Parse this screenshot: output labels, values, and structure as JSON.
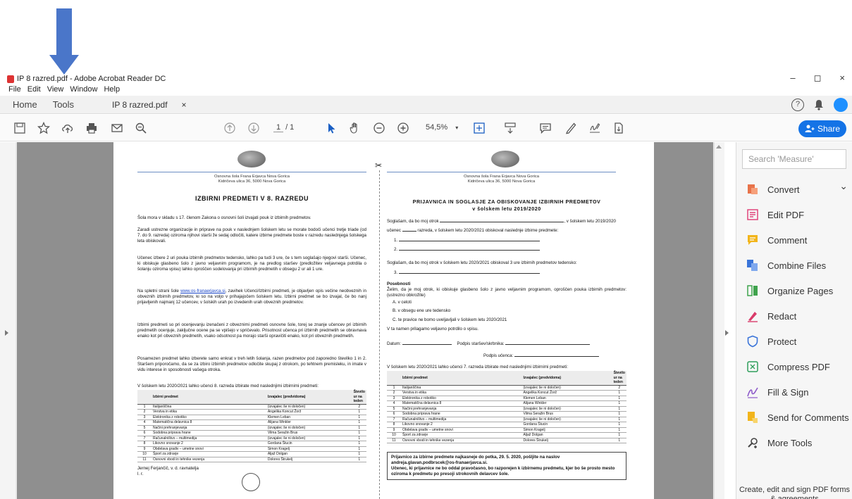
{
  "window": {
    "title": "IP 8 razred.pdf - Adobe Acrobat Reader DC",
    "controls": [
      "–",
      "◻",
      "×"
    ]
  },
  "menu": [
    "File",
    "Edit",
    "View",
    "Window",
    "Help"
  ],
  "tabs": {
    "home": "Home",
    "tools": "Tools",
    "document": "IP 8 razred.pdf",
    "close": "×"
  },
  "toolbar": {
    "page_current": "1",
    "page_total": "/ 1",
    "zoom": "54,5%",
    "share_label": "Share"
  },
  "document": {
    "school_name": "Osnovna šola Frana Erjavca Nova Gorica",
    "school_address": "Kidričeva ulica 36, 5000 Nova Gorica",
    "left": {
      "title": "IZBIRNI PREDMETI V 8. RAZREDU",
      "p1": "Šola mora v skladu s 17. členom Zakona o osnovni šoli izvajati pouk iz izbirnih predmetov.",
      "p2": "Zaradi ustrezne organizacije in priprave na pouk v naslednjem šolskem letu se morate bodoči učenci tretje triade (od 7. do 9. razreda) oziroma njihovi starši že sedaj odločiti, katere izbirne predmete boste v razredu naslednjega šolskega leta obiskovali.",
      "p3": "Učenec izbere 2 uri pouka izbirnih predmetov tedensko, lahko pa tudi 3 ure, če s tem soglašajo njegovi starši. Učenec, ki obiskuje glasbeno šolo z javno veljavnim programom, je na predlog staršev (predložitev veljavnega potrdila o šolanju oziroma vpisu) lahko oproščen sodelovanja pri izbirnih predmetih v obsegu 2 ur ali 1 ure.",
      "p4_a": "Na spletni strani šole ",
      "p4_link": "www.os-franaerjavca.si",
      "p4_b": ", zavihek Učenci/Izbirni predmeti, je objavljen opis večine neobveznih in obveznih izbirnih predmetov, ki so na voljo v prihajajočem šolskem letu. Izbirni predmet se bo izvajal, če bo nanj prijavljenih najmanj 12 učencev, v šolskih urah po izvedenih urah obveznih predmetov.",
      "p5": "Izbirni predmeti so pri ocenjevanju izenačeni z obveznimi predmeti osnovne šole, torej se znanje učencev pri izbirnih predmetih ocenjuje, zaključne ocene pa se vpišejo v spričevalo. Prisotnost učenca pri izbirnih predmetih se obravnava enako kot pri obveznih predmetih, vsako odsotnost pa morajo starši opravičiti enako, kot pri obveznih predmetih.",
      "p6": "Posamezen predmet lahko izberete samo enkrat v treh letih šolanja, razen predmetov pod zaporedno številko 1 in 2. Staršem priporočamo, da se za izbiro izbirnih predmetov odločite skupaj z otrokom, po tehtnem premisleku, in imate v vidu interese in sposobnosti vašega otroka.",
      "table_intro": "V šolskem letu 2020/2021 lahko učenci 8. razreda izbirate med naslednjimi izbirnimi predmeti:",
      "signature": "Jernej Ferjančič, v. d. ravnatelja",
      "signature2": "l. r."
    },
    "table": {
      "headers": [
        "",
        "Izbirni predmet",
        "Izvajalec (predvidoma)",
        "Število ur na teden"
      ],
      "rows": [
        [
          "1",
          "Italijanščina",
          "(izvajalec še ni določen)",
          "2"
        ],
        [
          "2",
          "Verstva in etika",
          "Angelika Koncut Žorž",
          "1"
        ],
        [
          "3",
          "Elektronika z robotiko",
          "Klemen Leban",
          "1"
        ],
        [
          "4",
          "Matematična delavnica 8",
          "Alijana Winkler",
          "1"
        ],
        [
          "5",
          "Načini prehranjevanja",
          "(izvajalec še ni določen)",
          "1"
        ],
        [
          "6",
          "Sodobna priprava hrane",
          "Vilma Seražin Brus",
          "1"
        ],
        [
          "7",
          "Računalništvo – multimedija",
          "(izvajalec še ni določen)",
          "1"
        ],
        [
          "8",
          "Likovno snovanje 2",
          "Gordana Štucin",
          "1"
        ],
        [
          "9",
          "Obdelava gradiv – umetne snovi",
          "Simon Kragelj",
          "1"
        ],
        [
          "10",
          "Šport za zdravje",
          "Aljaž Dolgan",
          "1"
        ],
        [
          "11",
          "Osnovni vbodi in tehnike vezenja",
          "Dolores Štrukelj",
          "1"
        ]
      ]
    },
    "right": {
      "title1": "PRIJAVNICA IN SOGLASJE ZA OBISKOVANJE IZBIRNIH PREDMETOV",
      "title2": "v šolskem letu 2019/2020",
      "l1_a": "Soglašam, da bo moj otrok",
      "l1_b": ", v šolskem letu 2019/2020",
      "l2_a": "učenec",
      "l2_b": "razreda, v šolskem letu 2020/2021 obiskoval naslednje izbirne predmete:",
      "item1": "1.",
      "item2": "2.",
      "l3": "Soglašam, da bo moj otrok v šolskem letu 2020/2021 obiskoval 3 ure izbirnih predmetov tedensko:",
      "item3": "3.",
      "pos_title": "Posebnosti",
      "pos_text": "Želim, da je moj otrok, ki obiskuje glasbeno šolo z javno veljavnim programom, oproščen pouka izbirnih predmetov: (ustrezno obkrožite)",
      "optA": "A.   v celoti",
      "optB": "B.   v obsegu ene ure tedensko",
      "optC": "C.   te pravice ne bomo uveljavljali v šolskem letu 2020/2021",
      "attach": "V ta namen prilagamo veljavno potrdilo o vpisu.",
      "date_label": "Datum:",
      "parent_sig": "Podpis staršev/skrbnika:",
      "student_sig": "Podpis učenca:",
      "table_intro": "V šolskem letu 2020/2021 lahko učenci 7. razreda izbirate med naslednjimi izbirnimi predmeti:",
      "notice_1": "Prijavnico za izbirne predmete najkasneje do petka, 29. 5. 2020, pošljite na naslov andreja.glavan.podbrscek@os-franaerjavca.si.",
      "notice_2": "Učenec, ki prijavnice ne bo oddal pravočasno, bo razporejen k izbirnemu predmetu, kjer bo še prosto mesto oziroma k predmetu po presoji strokovnih delavcev šole."
    }
  },
  "right_panel": {
    "search_placeholder": "Search 'Measure'",
    "tools": [
      {
        "label": "Convert",
        "icon": "convert-icon",
        "color": "#e8734a"
      },
      {
        "label": "Edit PDF",
        "icon": "edit-pdf-icon",
        "color": "#e0457b"
      },
      {
        "label": "Comment",
        "icon": "comment-icon",
        "color": "#f2b51b"
      },
      {
        "label": "Combine Files",
        "icon": "combine-files-icon",
        "color": "#3a74d9"
      },
      {
        "label": "Organize Pages",
        "icon": "organize-pages-icon",
        "color": "#3fa34d"
      },
      {
        "label": "Redact",
        "icon": "redact-icon",
        "color": "#d93b6a"
      },
      {
        "label": "Protect",
        "icon": "protect-icon",
        "color": "#3a74d9"
      },
      {
        "label": "Compress PDF",
        "icon": "compress-pdf-icon",
        "color": "#2e9e5b"
      },
      {
        "label": "Fill & Sign",
        "icon": "fill-sign-icon",
        "color": "#8d5ac9"
      },
      {
        "label": "Send for Comments",
        "icon": "send-for-comments-icon",
        "color": "#f2b51b"
      },
      {
        "label": "More Tools",
        "icon": "more-tools-icon",
        "color": "#444444"
      }
    ],
    "footer": "Create, edit and sign PDF forms & agreements"
  }
}
